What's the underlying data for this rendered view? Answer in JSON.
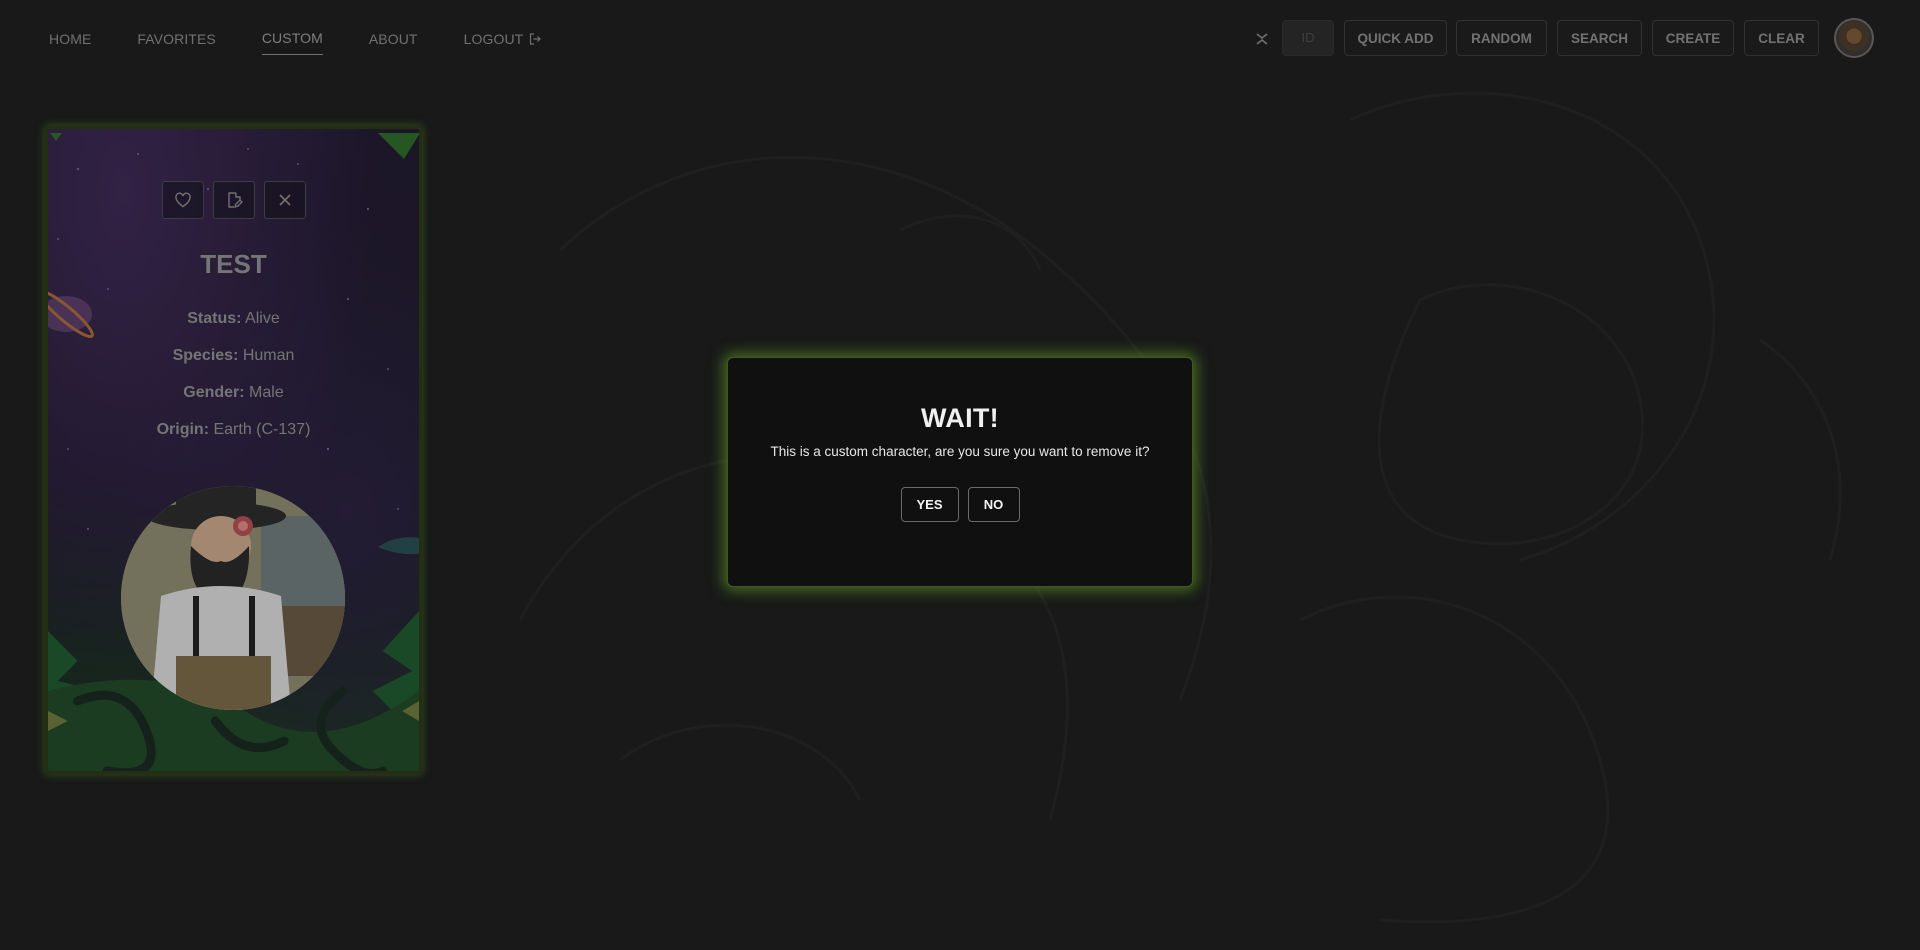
{
  "nav": {
    "links": [
      {
        "label": "HOME"
      },
      {
        "label": "FAVORITES"
      },
      {
        "label": "CUSTOM",
        "active": true
      },
      {
        "label": "ABOUT"
      },
      {
        "label": "LOGOUT"
      }
    ]
  },
  "toolbar": {
    "id_placeholder": "ID",
    "buttons": [
      "QUICK ADD",
      "RANDOM",
      "SEARCH",
      "CREATE",
      "CLEAR"
    ]
  },
  "card": {
    "name": "TEST",
    "fields": [
      {
        "label": "Status:",
        "value": "Alive"
      },
      {
        "label": "Species:",
        "value": "Human"
      },
      {
        "label": "Gender:",
        "value": "Male"
      },
      {
        "label": "Origin:",
        "value": "Earth (C-137)"
      }
    ],
    "actions": [
      "heart-icon",
      "edit-file-icon",
      "close-icon"
    ]
  },
  "modal": {
    "title": "WAIT!",
    "message": "This is a custom character, are you sure you want to remove it?",
    "yes_label": "YES",
    "no_label": "NO"
  },
  "colors": {
    "background": "#1e1f1e",
    "accent_glow": "#6eaa28",
    "modal_bg": "#101010"
  }
}
